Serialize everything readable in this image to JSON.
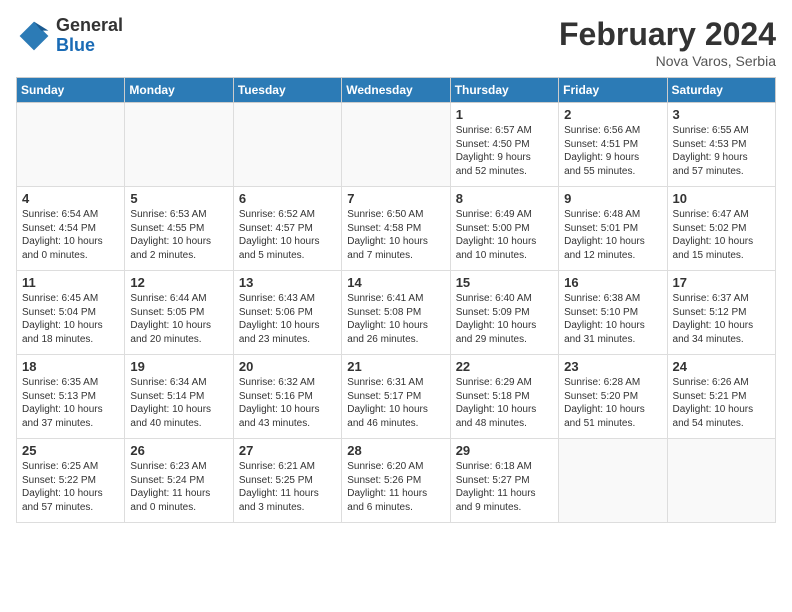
{
  "header": {
    "logo_general": "General",
    "logo_blue": "Blue",
    "month_title": "February 2024",
    "subtitle": "Nova Varos, Serbia"
  },
  "days_of_week": [
    "Sunday",
    "Monday",
    "Tuesday",
    "Wednesday",
    "Thursday",
    "Friday",
    "Saturday"
  ],
  "weeks": [
    [
      {
        "day": "",
        "info": ""
      },
      {
        "day": "",
        "info": ""
      },
      {
        "day": "",
        "info": ""
      },
      {
        "day": "",
        "info": ""
      },
      {
        "day": "1",
        "info": "Sunrise: 6:57 AM\nSunset: 4:50 PM\nDaylight: 9 hours\nand 52 minutes."
      },
      {
        "day": "2",
        "info": "Sunrise: 6:56 AM\nSunset: 4:51 PM\nDaylight: 9 hours\nand 55 minutes."
      },
      {
        "day": "3",
        "info": "Sunrise: 6:55 AM\nSunset: 4:53 PM\nDaylight: 9 hours\nand 57 minutes."
      }
    ],
    [
      {
        "day": "4",
        "info": "Sunrise: 6:54 AM\nSunset: 4:54 PM\nDaylight: 10 hours\nand 0 minutes."
      },
      {
        "day": "5",
        "info": "Sunrise: 6:53 AM\nSunset: 4:55 PM\nDaylight: 10 hours\nand 2 minutes."
      },
      {
        "day": "6",
        "info": "Sunrise: 6:52 AM\nSunset: 4:57 PM\nDaylight: 10 hours\nand 5 minutes."
      },
      {
        "day": "7",
        "info": "Sunrise: 6:50 AM\nSunset: 4:58 PM\nDaylight: 10 hours\nand 7 minutes."
      },
      {
        "day": "8",
        "info": "Sunrise: 6:49 AM\nSunset: 5:00 PM\nDaylight: 10 hours\nand 10 minutes."
      },
      {
        "day": "9",
        "info": "Sunrise: 6:48 AM\nSunset: 5:01 PM\nDaylight: 10 hours\nand 12 minutes."
      },
      {
        "day": "10",
        "info": "Sunrise: 6:47 AM\nSunset: 5:02 PM\nDaylight: 10 hours\nand 15 minutes."
      }
    ],
    [
      {
        "day": "11",
        "info": "Sunrise: 6:45 AM\nSunset: 5:04 PM\nDaylight: 10 hours\nand 18 minutes."
      },
      {
        "day": "12",
        "info": "Sunrise: 6:44 AM\nSunset: 5:05 PM\nDaylight: 10 hours\nand 20 minutes."
      },
      {
        "day": "13",
        "info": "Sunrise: 6:43 AM\nSunset: 5:06 PM\nDaylight: 10 hours\nand 23 minutes."
      },
      {
        "day": "14",
        "info": "Sunrise: 6:41 AM\nSunset: 5:08 PM\nDaylight: 10 hours\nand 26 minutes."
      },
      {
        "day": "15",
        "info": "Sunrise: 6:40 AM\nSunset: 5:09 PM\nDaylight: 10 hours\nand 29 minutes."
      },
      {
        "day": "16",
        "info": "Sunrise: 6:38 AM\nSunset: 5:10 PM\nDaylight: 10 hours\nand 31 minutes."
      },
      {
        "day": "17",
        "info": "Sunrise: 6:37 AM\nSunset: 5:12 PM\nDaylight: 10 hours\nand 34 minutes."
      }
    ],
    [
      {
        "day": "18",
        "info": "Sunrise: 6:35 AM\nSunset: 5:13 PM\nDaylight: 10 hours\nand 37 minutes."
      },
      {
        "day": "19",
        "info": "Sunrise: 6:34 AM\nSunset: 5:14 PM\nDaylight: 10 hours\nand 40 minutes."
      },
      {
        "day": "20",
        "info": "Sunrise: 6:32 AM\nSunset: 5:16 PM\nDaylight: 10 hours\nand 43 minutes."
      },
      {
        "day": "21",
        "info": "Sunrise: 6:31 AM\nSunset: 5:17 PM\nDaylight: 10 hours\nand 46 minutes."
      },
      {
        "day": "22",
        "info": "Sunrise: 6:29 AM\nSunset: 5:18 PM\nDaylight: 10 hours\nand 48 minutes."
      },
      {
        "day": "23",
        "info": "Sunrise: 6:28 AM\nSunset: 5:20 PM\nDaylight: 10 hours\nand 51 minutes."
      },
      {
        "day": "24",
        "info": "Sunrise: 6:26 AM\nSunset: 5:21 PM\nDaylight: 10 hours\nand 54 minutes."
      }
    ],
    [
      {
        "day": "25",
        "info": "Sunrise: 6:25 AM\nSunset: 5:22 PM\nDaylight: 10 hours\nand 57 minutes."
      },
      {
        "day": "26",
        "info": "Sunrise: 6:23 AM\nSunset: 5:24 PM\nDaylight: 11 hours\nand 0 minutes."
      },
      {
        "day": "27",
        "info": "Sunrise: 6:21 AM\nSunset: 5:25 PM\nDaylight: 11 hours\nand 3 minutes."
      },
      {
        "day": "28",
        "info": "Sunrise: 6:20 AM\nSunset: 5:26 PM\nDaylight: 11 hours\nand 6 minutes."
      },
      {
        "day": "29",
        "info": "Sunrise: 6:18 AM\nSunset: 5:27 PM\nDaylight: 11 hours\nand 9 minutes."
      },
      {
        "day": "",
        "info": ""
      },
      {
        "day": "",
        "info": ""
      }
    ]
  ]
}
